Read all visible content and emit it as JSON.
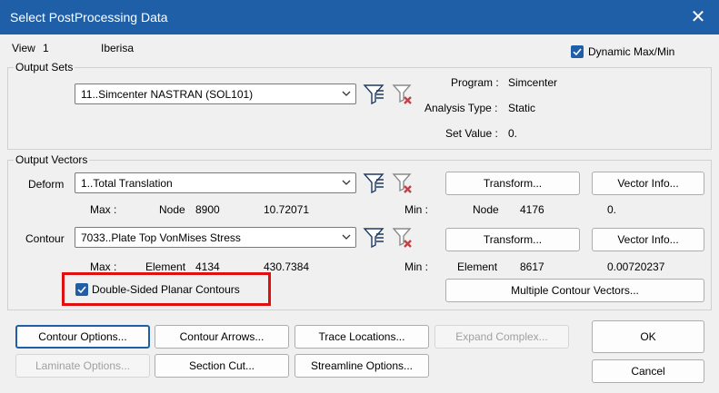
{
  "window": {
    "title": "Select PostProcessing Data",
    "close_glyph": "✕"
  },
  "view": {
    "label": "View",
    "number": "1",
    "name": "Iberisa"
  },
  "dynamic_maxmin": {
    "label": "Dynamic Max/Min",
    "checked": true
  },
  "output_sets": {
    "group_label": "Output Sets",
    "selected": "11..Simcenter NASTRAN (SOL101)",
    "program_label": "Program :",
    "program_value": "Simcenter",
    "analysis_label": "Analysis Type :",
    "analysis_value": "Static",
    "setvalue_label": "Set Value :",
    "setvalue_value": "0."
  },
  "output_vectors": {
    "group_label": "Output Vectors",
    "deform": {
      "label": "Deform",
      "selected": "1..Total Translation",
      "max_label": "Max :",
      "max_type": "Node",
      "max_id": "8900",
      "max_value": "10.72071",
      "min_label": "Min :",
      "min_type": "Node",
      "min_id": "4176",
      "min_value": "0.",
      "transform_label": "Transform...",
      "vector_info_label": "Vector Info..."
    },
    "contour": {
      "label": "Contour",
      "selected": "7033..Plate Top VonMises Stress",
      "max_label": "Max :",
      "max_type": "Element",
      "max_id": "4134",
      "max_value": "430.7384",
      "min_label": "Min :",
      "min_type": "Element",
      "min_id": "8617",
      "min_value": "0.00720237",
      "transform_label": "Transform...",
      "vector_info_label": "Vector Info..."
    },
    "double_sided": {
      "label": "Double-Sided Planar Contours",
      "checked": true
    },
    "multiple_contour_label": "Multiple Contour Vectors..."
  },
  "buttons": {
    "contour_options": "Contour Options...",
    "contour_arrows": "Contour Arrows...",
    "trace_locations": "Trace Locations...",
    "expand_complex": "Expand Complex...",
    "laminate_options": "Laminate Options...",
    "section_cut": "Section Cut...",
    "streamline_options": "Streamline Options...",
    "ok": "OK",
    "cancel": "Cancel"
  },
  "colors": {
    "accent": "#1f5fa8",
    "highlight": "#e01010"
  }
}
